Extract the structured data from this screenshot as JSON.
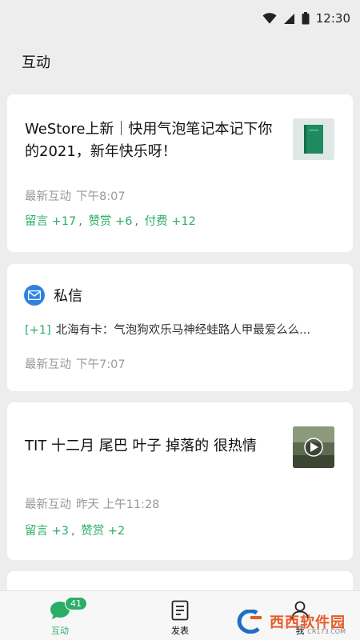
{
  "status_bar": {
    "time": "12:30"
  },
  "page": {
    "title": "互动"
  },
  "cards": [
    {
      "title": "WeStore上新｜快用气泡笔记本记下你的2021，新年快乐呀！",
      "meta_label": "最新互动",
      "meta_time": "下午8:07",
      "stats": [
        "留言 +17",
        "赞赏 +6",
        "付费 +12"
      ],
      "thumbnail": "green-notebook-thumbnail"
    },
    {
      "title": "私信",
      "icon": "mail-icon",
      "badge": "[+1]",
      "message": "北海有卡：气泡狗欢乐马神经蛙路人甲最爱么么...",
      "meta_label": "最新互动",
      "meta_time": "下午7:07"
    },
    {
      "title": "TIT 十二月 尾巴 叶子 掉落的 很热情",
      "meta_label": "最新互动",
      "meta_time": "昨天 上午11:28",
      "stats": [
        "留言 +3",
        "赞赏 +2"
      ],
      "thumbnail": "video-thumbnail"
    }
  ],
  "tab_bar": {
    "tabs": [
      {
        "label": "互动",
        "badge": "41",
        "icon": "chat-bubble-icon"
      },
      {
        "label": "发表",
        "icon": "document-icon"
      },
      {
        "label": "我",
        "icon": "person-icon"
      }
    ]
  },
  "watermark": {
    "text": "西西软件园",
    "sub": "CR173.COM"
  },
  "colors": {
    "accent": "#2aae67",
    "background": "#ededed",
    "card": "#ffffff",
    "mail_icon": "#2f83e0"
  }
}
